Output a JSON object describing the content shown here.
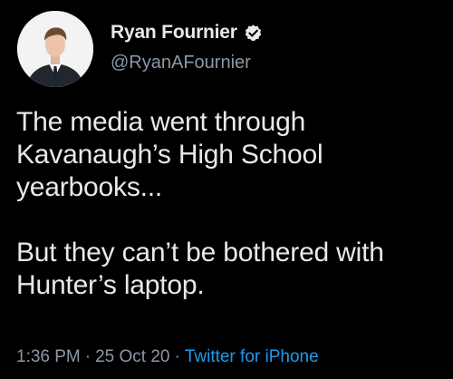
{
  "author": {
    "display_name": "Ryan Fournier",
    "handle": "@RyanAFournier",
    "verified": true,
    "avatar_icon": "user-portrait-avatar"
  },
  "tweet": {
    "paragraphs": [
      "The media went through Kavanaugh’s High School yearbooks...",
      "But they can’t be bothered with Hunter’s laptop."
    ]
  },
  "meta": {
    "time": "1:36 PM",
    "date": "25 Oct 20",
    "separator": "·",
    "source": "Twitter for iPhone"
  },
  "colors": {
    "background": "#000000",
    "text": "#e7e9ea",
    "secondary": "#8b98a5",
    "link": "#1d9bf0"
  }
}
